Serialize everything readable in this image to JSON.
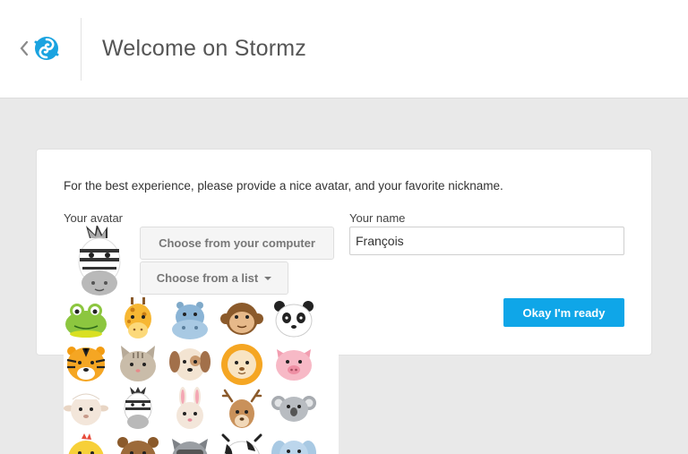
{
  "header": {
    "title": "Welcome on Stormz",
    "back_icon": "chevron-left-icon",
    "logo_icon": "stormz-swirl-icon",
    "brand_color": "#1aa3e0"
  },
  "form": {
    "intro": "For the best experience, please provide a nice avatar, and your favorite nickname.",
    "avatar_label": "Your avatar",
    "choose_computer_label": "Choose from your computer",
    "choose_list_label": "Choose from a list",
    "name_label": "Your name",
    "name_value": "François",
    "submit_label": "Okay I'm ready",
    "accent_color": "#0fa6e8"
  },
  "selected_avatar": "zebra",
  "avatar_list": [
    "frog",
    "giraffe",
    "hippo",
    "monkey",
    "panda",
    "tiger",
    "cat",
    "dog",
    "lion",
    "pig",
    "sheep",
    "zebra",
    "rabbit",
    "deer",
    "koala",
    "chick",
    "bear",
    "raccoon",
    "cow",
    "elephant"
  ]
}
